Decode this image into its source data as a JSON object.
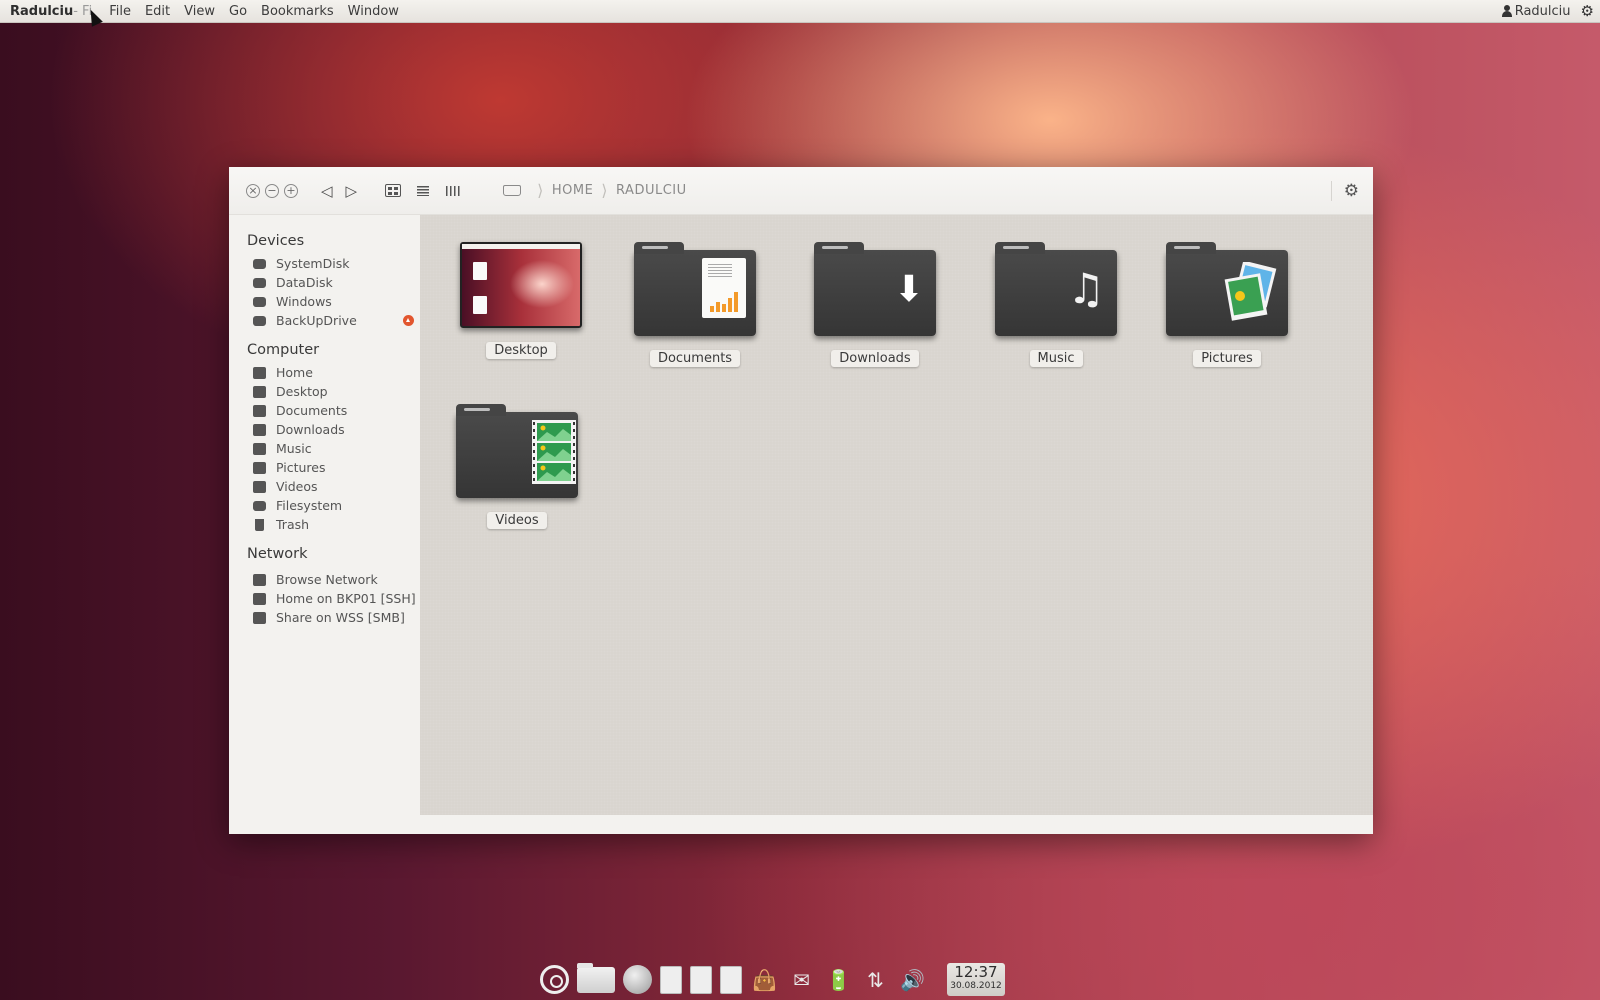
{
  "top_panel": {
    "app_title": "Radulciu",
    "app_title_suffix": "- Fi",
    "menu": [
      "File",
      "Edit",
      "View",
      "Go",
      "Bookmarks",
      "Window"
    ],
    "user": "Radulciu"
  },
  "toolbar": {
    "breadcrumbs": [
      "HOME",
      "RADULCIU"
    ]
  },
  "sidebar": {
    "devices_title": "Devices",
    "devices": [
      "SystemDisk",
      "DataDisk",
      "Windows",
      "BackUpDrive"
    ],
    "computer_title": "Computer",
    "computer": [
      "Home",
      "Desktop",
      "Documents",
      "Downloads",
      "Music",
      "Pictures",
      "Videos",
      "Filesystem",
      "Trash"
    ],
    "network_title": "Network",
    "network": [
      "Browse Network",
      "Home on BKP01 [SSH]",
      "Share on WSS [SMB]"
    ]
  },
  "folders": [
    {
      "label": "Desktop"
    },
    {
      "label": "Documents"
    },
    {
      "label": "Downloads"
    },
    {
      "label": "Music"
    },
    {
      "label": "Pictures"
    },
    {
      "label": "Videos"
    }
  ],
  "clock": {
    "time": "12:37",
    "date": "30.08.2012"
  },
  "colors": {
    "eject_badge": "#e2562e",
    "document_chart": "#f39a2a",
    "content_bg": "#d9d5cf"
  },
  "icons": {
    "panel_settings": "gear-icon",
    "toolbar_settings": "gear-icon",
    "back": "triangle-left-icon",
    "forward": "triangle-right-icon"
  }
}
